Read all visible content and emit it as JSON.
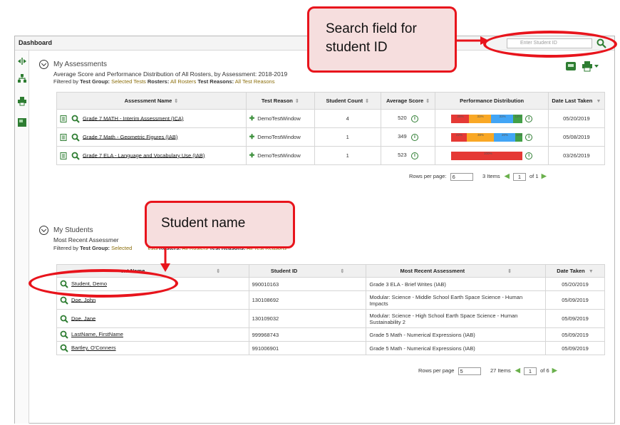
{
  "app": {
    "title": "Dashboard"
  },
  "search": {
    "placeholder": "Enter Student ID"
  },
  "callouts": {
    "search": "Search field for student ID",
    "student": "Student name"
  },
  "assessments": {
    "title": "My Assessments",
    "subtitle": "Average Score and Performance Distribution of All Rosters, by Assessment: 2018-2019",
    "filter": {
      "prefix": "Filtered by",
      "tg_label": "Test Group:",
      "tg_value": "Selected Tests",
      "ro_label": "Rosters:",
      "ro_value": "All Rosters",
      "tr_label": "Test Reasons:",
      "tr_value": "All Test Reasons"
    },
    "columns": [
      "Assessment Name",
      "Test Reason",
      "Student Count",
      "Average Score",
      "Performance Distribution",
      "Date Last Taken"
    ],
    "rows": [
      {
        "name": "Grade 7 MATH - Interim Assessment (ICA)",
        "reason": "DemoTestWindow",
        "count": "4",
        "score": "520",
        "date": "05/20/2019",
        "dist": [
          {
            "pct": 25,
            "color": "#e53935"
          },
          {
            "pct": 31,
            "color": "#f9a825"
          },
          {
            "pct": 31,
            "color": "#42a5f5"
          },
          {
            "pct": 13,
            "color": "#43a047"
          }
        ],
        "dist_labels": [
          "25%",
          "31%",
          "31%",
          "12%"
        ]
      },
      {
        "name": "Grade 7 Math - Geometric Figures (IAB)",
        "reason": "DemoTestWindow",
        "count": "1",
        "score": "349",
        "date": "05/08/2019",
        "dist": [
          {
            "pct": 22,
            "color": "#e53935"
          },
          {
            "pct": 38,
            "color": "#f9a825"
          },
          {
            "pct": 30,
            "color": "#42a5f5"
          },
          {
            "pct": 10,
            "color": "#43a047"
          }
        ],
        "dist_labels": [
          "22%",
          "38%",
          "20%",
          "10%"
        ]
      },
      {
        "name": "Grade 7 ELA - Language and Vocabulary Use (IAB)",
        "reason": "DemoTestWindow",
        "count": "1",
        "score": "523",
        "date": "03/26/2019",
        "dist": [
          {
            "pct": 100,
            "color": "#e53935"
          }
        ],
        "dist_labels": [
          "100%"
        ]
      }
    ],
    "pager": {
      "rows_label": "Rows per page:",
      "rows_value": "6",
      "items": "3 Items",
      "page": "1",
      "of": "of 1"
    }
  },
  "students": {
    "title": "My Students",
    "subtitle": "Most Recent Assessmer",
    "filter": {
      "prefix": "Filtered by",
      "tg_label": "Test Group:",
      "tg_value": "Selected",
      "tg_value2": "ests",
      "ro_label": "Rosters:",
      "ro_value": "All Rosters",
      "tr_label": "Test Reasons:",
      "tr_value": "All Test Reasons"
    },
    "columns": [
      "ent Name",
      "Student ID",
      "Most Recent Assessment",
      "Date Taken"
    ],
    "rows": [
      {
        "name": "Student, Demo",
        "id": "990010163",
        "assessment": "Grade 3 ELA - Brief Writes (IAB)",
        "date": "05/20/2019"
      },
      {
        "name": "Doe, John",
        "id": "130108692",
        "assessment": "Modular: Science - Middle School Earth Space Science - Human Impacts",
        "date": "05/09/2019"
      },
      {
        "name": "Doe, Jane",
        "id": "130109032",
        "assessment": "Modular: Science - High School Earth Space Science - Human Sustainability 2",
        "date": "05/09/2019"
      },
      {
        "name": "LastName, FirstName",
        "id": "999968743",
        "assessment": "Grade 5 Math - Numerical Expressions (IAB)",
        "date": "05/09/2019"
      },
      {
        "name": "Bartley, O'Conners",
        "id": "991006901",
        "assessment": "Grade 5 Math - Numerical Expressions (IAB)",
        "date": "05/09/2019"
      }
    ],
    "pager": {
      "rows_label": "Rows per page",
      "rows_value": "5",
      "items": "27 Items",
      "page": "1",
      "of": "of 6"
    }
  }
}
